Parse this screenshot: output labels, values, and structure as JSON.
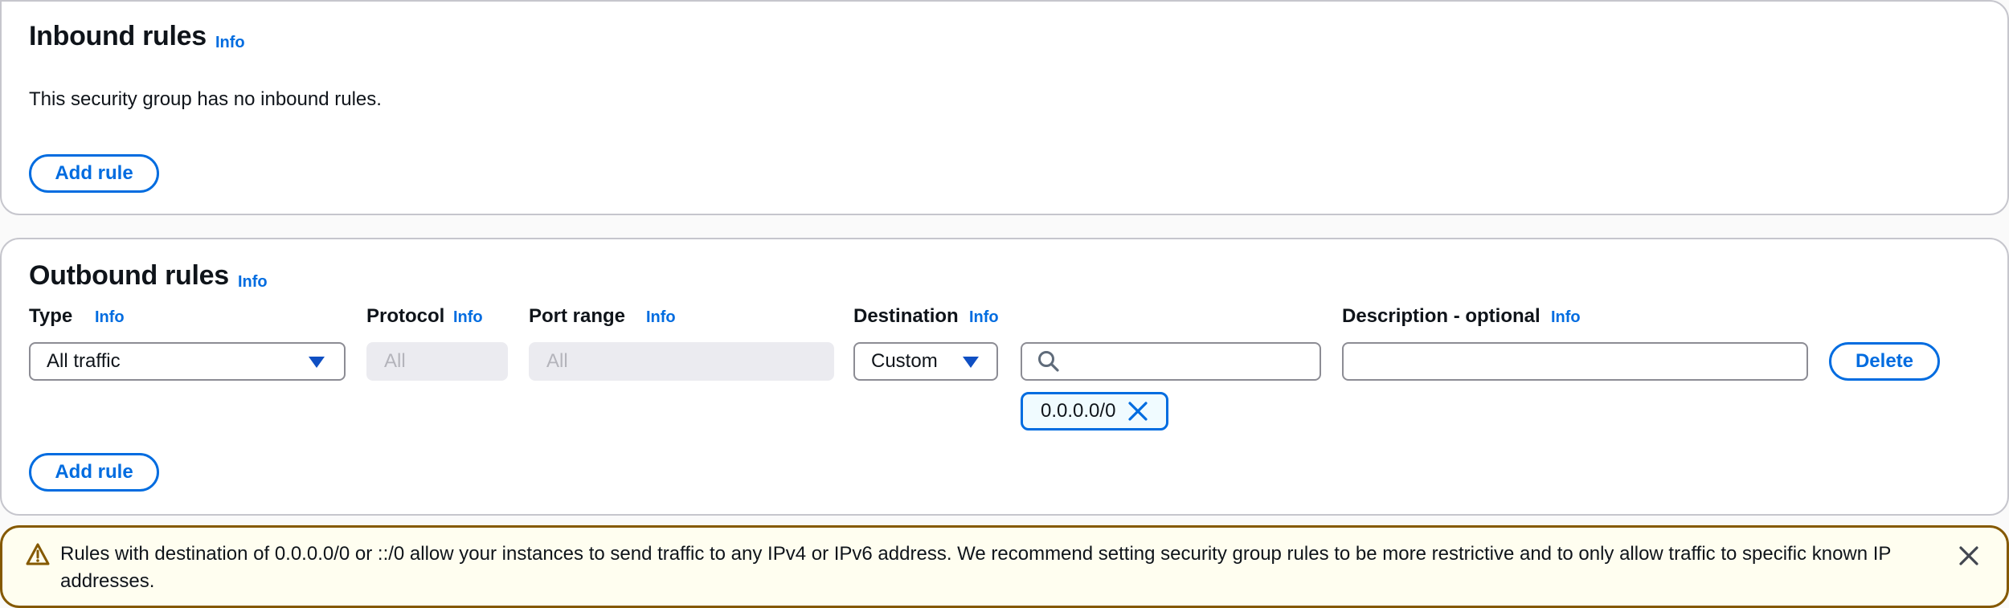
{
  "inbound": {
    "title": "Inbound rules",
    "info_label": "Info",
    "empty_message": "This security group has no inbound rules.",
    "add_rule_label": "Add rule"
  },
  "outbound": {
    "title": "Outbound rules",
    "info_label": "Info",
    "columns": {
      "type": "Type",
      "protocol": "Protocol",
      "port_range": "Port range",
      "destination": "Destination",
      "description": "Description - optional",
      "info_label": "Info"
    },
    "rule": {
      "type_value": "All traffic",
      "protocol_value": "All",
      "port_range_value": "All",
      "destination_type": "Custom",
      "destination_search_value": "",
      "destination_token": "0.0.0.0/0",
      "description_value": "",
      "delete_label": "Delete"
    },
    "add_rule_label": "Add rule"
  },
  "warning": {
    "message": "Rules with destination of 0.0.0.0/0 or ::/0 allow your instances to send traffic to any IPv4 or IPv6 address. We recommend setting security group rules to be more restrictive and to only allow traffic to specific known IP addresses."
  },
  "colors": {
    "link": "#006ce0",
    "warning_border": "#855900",
    "warning_bg": "#fffef0"
  },
  "icons": {
    "warning": "warning-triangle-icon",
    "dismiss": "close-icon",
    "search": "search-icon",
    "token_remove": "close-icon",
    "dropdown": "caret-down-icon"
  }
}
